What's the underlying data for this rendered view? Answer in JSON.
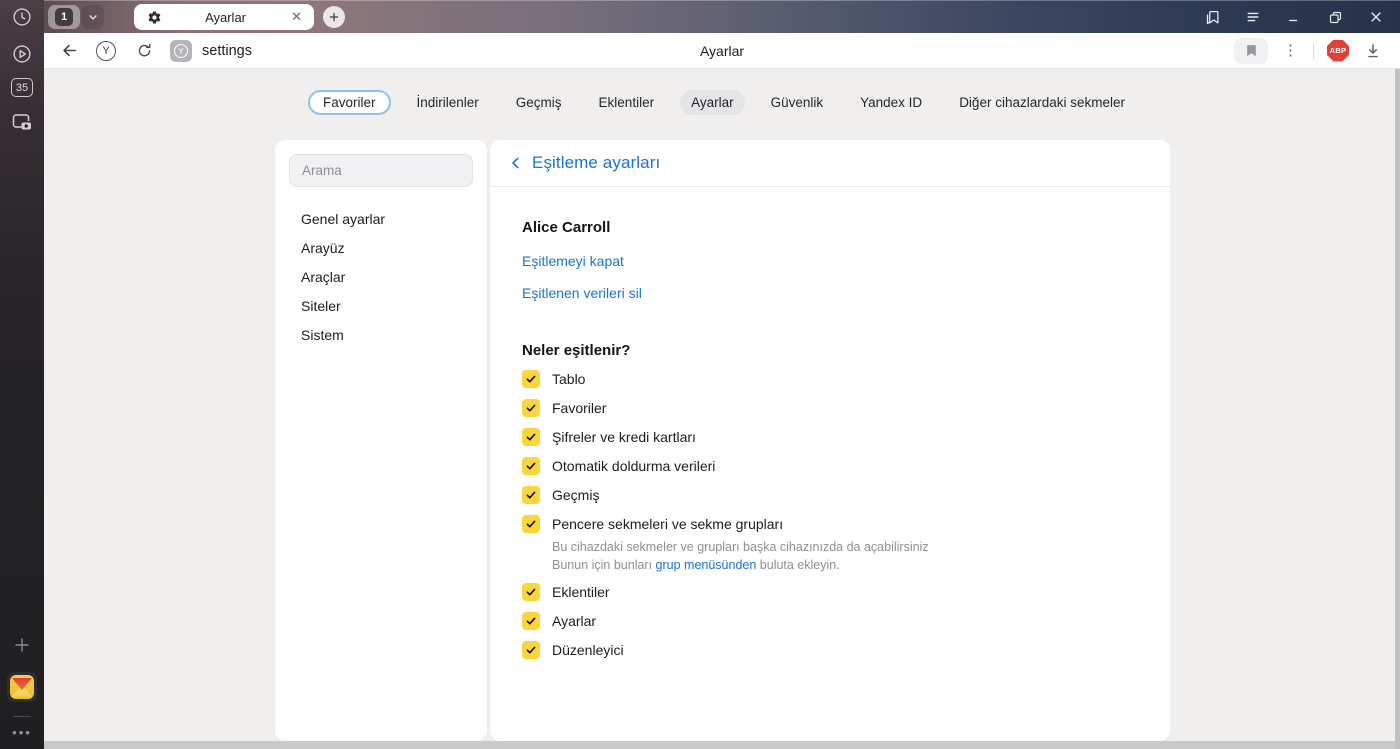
{
  "titlebar": {
    "tab_group_count": "1",
    "tab_title": "Ayarlar",
    "tab_close": "✕"
  },
  "toolbar": {
    "url": "settings",
    "page_title": "Ayarlar",
    "abp_label": "ABP",
    "yandex_letter": "Y",
    "favicon_letter": "Y"
  },
  "left_rail": {
    "tab_counter": "35",
    "more_dots": "•••"
  },
  "nav": {
    "items": [
      {
        "label": "Favoriler"
      },
      {
        "label": "İndirilenler"
      },
      {
        "label": "Geçmiş"
      },
      {
        "label": "Eklentiler"
      },
      {
        "label": "Ayarlar"
      },
      {
        "label": "Güvenlik"
      },
      {
        "label": "Yandex ID"
      },
      {
        "label": "Diğer cihazlardaki sekmeler"
      }
    ]
  },
  "sidebar": {
    "search_placeholder": "Arama",
    "items": [
      {
        "label": "Genel ayarlar"
      },
      {
        "label": "Arayüz"
      },
      {
        "label": "Araçlar"
      },
      {
        "label": "Siteler"
      },
      {
        "label": "Sistem"
      }
    ]
  },
  "sync": {
    "title": "Eşitleme ayarları",
    "account": "Alice Carroll",
    "link_disable": "Eşitlemeyi kapat",
    "link_delete": "Eşitlenen verileri sil",
    "heading": "Neler eşitlenir?",
    "items": [
      {
        "label": "Tablo",
        "checked": true
      },
      {
        "label": "Favoriler",
        "checked": true
      },
      {
        "label": "Şifreler ve kredi kartları",
        "checked": true
      },
      {
        "label": "Otomatik doldurma verileri",
        "checked": true
      },
      {
        "label": "Geçmiş",
        "checked": true
      },
      {
        "label": "Pencere sekmeleri ve sekme grupları",
        "checked": true,
        "desc_line1": "Bu cihazdaki sekmeler ve grupları başka cihazınızda da açabilirsiniz",
        "desc_prefix": "Bunun için bunları ",
        "desc_link": "grup menüsünden",
        "desc_suffix": " buluta ekleyin."
      },
      {
        "label": "Eklentiler",
        "checked": true
      },
      {
        "label": "Ayarlar",
        "checked": true
      },
      {
        "label": "Düzenleyici",
        "checked": true
      }
    ]
  },
  "colors": {
    "accent_blue": "#1b72d8",
    "checkbox_yellow": "#fbd53c",
    "abp_red": "#e04038",
    "active_pill": "#e5e4e7"
  }
}
